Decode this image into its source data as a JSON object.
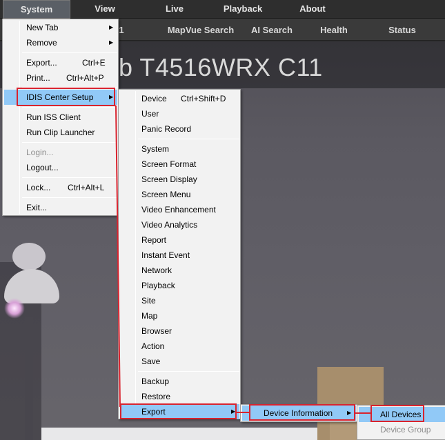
{
  "menubar": {
    "items": [
      {
        "label": "System",
        "active": true
      },
      {
        "label": "View"
      },
      {
        "label": "Live"
      },
      {
        "label": "Playback"
      },
      {
        "label": "About"
      }
    ]
  },
  "tabbar": {
    "items": [
      {
        "label": "1"
      },
      {
        "label": "MapVue Search"
      },
      {
        "label": "AI Search"
      },
      {
        "label": "Health"
      },
      {
        "label": "Status"
      }
    ]
  },
  "video": {
    "camera_title": "b T4516WRX C11"
  },
  "system_menu": {
    "items": [
      {
        "label": "New Tab",
        "submenu": true
      },
      {
        "label": "Remove",
        "submenu": true
      },
      {
        "label": "Export...",
        "shortcut": "Ctrl+E"
      },
      {
        "label": "Print...",
        "shortcut": "Ctrl+Alt+P"
      },
      {
        "label": "IDIS Center Setup",
        "submenu": true,
        "highlighted": true
      },
      {
        "label": "Run ISS Client"
      },
      {
        "label": "Run Clip Launcher"
      },
      {
        "label": "Login...",
        "disabled": true
      },
      {
        "label": "Logout..."
      },
      {
        "label": "Lock...",
        "shortcut": "Ctrl+Alt+L"
      },
      {
        "label": "Exit..."
      }
    ],
    "submenu_arrow": "▶"
  },
  "setup_menu": {
    "items": [
      {
        "label": "Device",
        "shortcut": "Ctrl+Shift+D"
      },
      {
        "label": "User"
      },
      {
        "label": "Panic Record"
      },
      {
        "label": "System"
      },
      {
        "label": "Screen Format"
      },
      {
        "label": "Screen Display"
      },
      {
        "label": "Screen Menu"
      },
      {
        "label": "Video Enhancement"
      },
      {
        "label": "Video Analytics"
      },
      {
        "label": "Report"
      },
      {
        "label": "Instant Event"
      },
      {
        "label": "Network"
      },
      {
        "label": "Playback"
      },
      {
        "label": "Site"
      },
      {
        "label": "Map"
      },
      {
        "label": "Browser"
      },
      {
        "label": "Action"
      },
      {
        "label": "Save"
      },
      {
        "label": "Backup"
      },
      {
        "label": "Restore"
      },
      {
        "label": "Export",
        "submenu": true,
        "highlighted": true
      }
    ]
  },
  "export_menu": {
    "items": [
      {
        "label": "Device Information",
        "submenu": true,
        "highlighted": true
      }
    ]
  },
  "device_info_menu": {
    "items": [
      {
        "label": "All Devices",
        "highlighted": true
      },
      {
        "label": "Device Group",
        "disabled": true
      }
    ]
  },
  "colors": {
    "highlight": "#91c9f7",
    "annotation": "#d9232e",
    "menubar_bg": "#2e2e2e",
    "menu_bg": "#f2f2f2"
  }
}
